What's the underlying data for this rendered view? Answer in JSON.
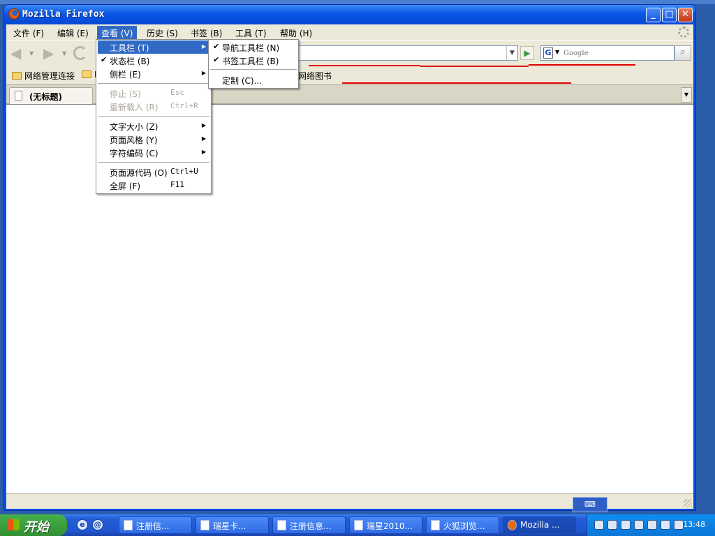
{
  "window": {
    "title": "Mozilla Firefox",
    "minimize_symbol": "_",
    "maximize_symbol": "□",
    "close_symbol": "✕"
  },
  "menubar": {
    "items": [
      "文件 (F)",
      "编辑 (E)",
      "查看 (V)",
      "历史 (S)",
      "书签 (B)",
      "工具 (T)",
      "帮助 (H)"
    ],
    "active": "查看 (V)"
  },
  "navbar": {
    "back_icon": "back-arrow-icon",
    "forward_icon": "forward-arrow-icon",
    "reload_icon": "reload-icon",
    "url_value": "",
    "go_icon": "go-arrow-icon",
    "search_engine": "G",
    "search_placeholder": "Google",
    "search_icon": "magnifier-icon"
  },
  "bookmarks": {
    "items": [
      "网络管理连接",
      "I",
      "网络图书"
    ]
  },
  "tabs": {
    "items": [
      "(无标题)"
    ]
  },
  "view_menu": {
    "items": [
      {
        "label": "工具栏  (T)",
        "shortcut": "",
        "submenu": true,
        "checked": false,
        "disabled": false,
        "highlighted": true
      },
      {
        "label": "状态栏  (B)",
        "shortcut": "",
        "submenu": false,
        "checked": true,
        "disabled": false,
        "highlighted": false
      },
      {
        "label": "侧栏  (E)",
        "shortcut": "",
        "submenu": true,
        "checked": false,
        "disabled": false,
        "highlighted": false
      },
      {
        "label": "停止  (S)",
        "shortcut": "Esc",
        "submenu": false,
        "checked": false,
        "disabled": true,
        "highlighted": false
      },
      {
        "label": "重新载入  (R)",
        "shortcut": "Ctrl+R",
        "submenu": false,
        "checked": false,
        "disabled": true,
        "highlighted": false
      },
      {
        "label": "文字大小  (Z)",
        "shortcut": "",
        "submenu": true,
        "checked": false,
        "disabled": false,
        "highlighted": false
      },
      {
        "label": "页面风格  (Y)",
        "shortcut": "",
        "submenu": true,
        "checked": false,
        "disabled": false,
        "highlighted": false
      },
      {
        "label": "字符编码  (C)",
        "shortcut": "",
        "submenu": true,
        "checked": false,
        "disabled": false,
        "highlighted": false
      },
      {
        "label": "页面源代码  (O)",
        "shortcut": "Ctrl+U",
        "submenu": false,
        "checked": false,
        "disabled": false,
        "highlighted": false
      },
      {
        "label": "全屏  (F)",
        "shortcut": "F11",
        "submenu": false,
        "checked": false,
        "disabled": false,
        "highlighted": false
      }
    ]
  },
  "toolbars_submenu": {
    "items": [
      {
        "label": "导航工具栏  (N)",
        "checked": true
      },
      {
        "label": "书签工具栏  (B)",
        "checked": true
      },
      {
        "label": "定制  (C)...",
        "checked": false
      }
    ]
  },
  "taskbar": {
    "start_label": "开始",
    "quick_launch": [
      "ie-icon",
      "outlook-icon"
    ],
    "tasks": [
      {
        "label": "注册信...",
        "active": false
      },
      {
        "label": "瑞星卡...",
        "active": false
      },
      {
        "label": "注册信息...",
        "active": false
      },
      {
        "label": "瑞星2010...",
        "active": false
      },
      {
        "label": "火狐浏览...",
        "active": false
      },
      {
        "label": "Mozilla ...",
        "active": true
      }
    ],
    "ime_label": "⌨",
    "clock": "13:48"
  },
  "colors": {
    "highlight": "#316ac5",
    "titlebar": "#0a56e6",
    "annotation_red": "#e00000",
    "taskbar": "#245dd7"
  }
}
